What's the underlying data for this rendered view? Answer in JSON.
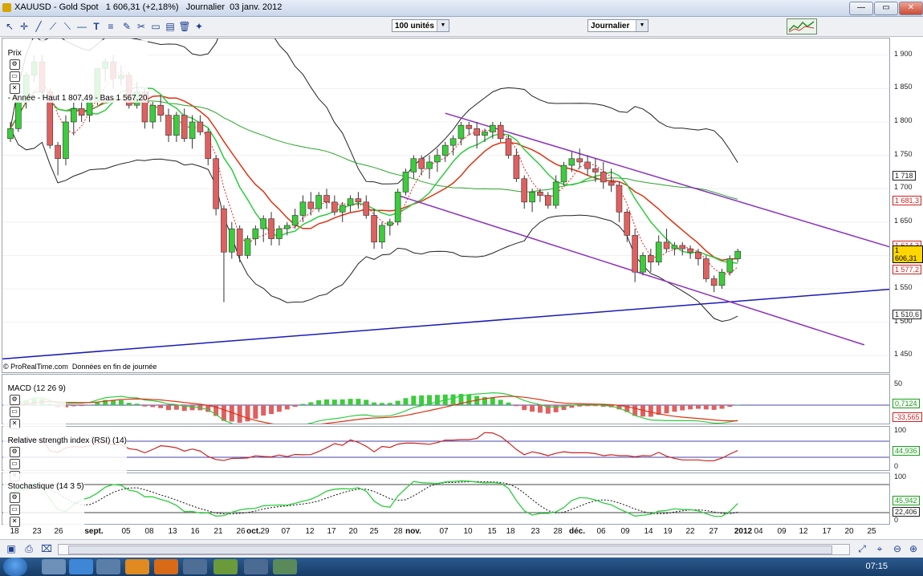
{
  "window": {
    "title": "XAUUSD - Gold Spot   1 606,31 (+2,18%)   Journalier  03 janv. 2012",
    "buttons": [
      "—",
      "▭",
      "✕"
    ]
  },
  "toolbar": {
    "units_value": "100 unités",
    "timeframe_value": "Journalier",
    "tools": [
      "pointer-icon",
      "crosshair-icon",
      "line-icon",
      "ray-icon",
      "trend-icon",
      "h-line-icon",
      "text-icon",
      "fibo-icon",
      "pencil-icon",
      "cut-icon",
      "rect-icon",
      "note-icon",
      "trash-icon",
      "magic-icon"
    ]
  },
  "panels": {
    "price": {
      "header": "Prix",
      "info": "- Année - Haut 1 807,49 - Bas 1 567,20",
      "credit": "© ProRealTime.com  Données en fin de journée",
      "y_labels": [
        "1 900",
        "1 850",
        "1 800",
        "1 750",
        "1 700",
        "1 650",
        "1 600",
        "1 550",
        "1 500",
        "1 450"
      ],
      "tags": [
        {
          "text": "1 718",
          "color": "#222222"
        },
        {
          "text": "1 681,3",
          "color": "#cc2222"
        },
        {
          "text": "1 614,3",
          "color": "#cc2222"
        },
        {
          "text": "1 606,31",
          "color": "#000000",
          "bg": "#ffd700"
        },
        {
          "text": "1 577,2",
          "color": "#cc2222"
        },
        {
          "text": "1 510,6",
          "color": "#222222"
        }
      ]
    },
    "macd": {
      "header": "MACD (12 26 9)",
      "y_labels": [
        "50"
      ],
      "tags": [
        {
          "text": "0,7124",
          "color": "#16a016"
        },
        {
          "text": "-33,565",
          "color": "#cc2222"
        }
      ]
    },
    "rsi": {
      "header": "Relative strength index (RSI) (14)",
      "y_labels": [
        "100",
        "0"
      ],
      "tags": [
        {
          "text": "44,936",
          "color": "#16a016"
        }
      ]
    },
    "stoch": {
      "header": "Stochastique (14 3 5)",
      "y_labels": [
        "100",
        "0"
      ],
      "tags": [
        {
          "text": "45,942",
          "color": "#16a016"
        },
        {
          "text": "22,406",
          "color": "#222222"
        }
      ]
    }
  },
  "x_axis": {
    "labels": [
      "18",
      "23",
      "26",
      "sept.",
      "05",
      "08",
      "13",
      "16",
      "21",
      "26",
      "29",
      "oct.",
      "07",
      "12",
      "17",
      "20",
      "25",
      "28",
      "nov.",
      "07",
      "10",
      "15",
      "18",
      "23",
      "28",
      "déc.",
      "06",
      "09",
      "14",
      "19",
      "22",
      "27",
      "2012",
      "04",
      "09",
      "12",
      "17",
      "20",
      "25"
    ],
    "bold": [
      "sept.",
      "oct.",
      "nov.",
      "déc.",
      "2012"
    ]
  },
  "taskbar": {
    "time": "07:15"
  },
  "chart_data": {
    "type": "candlestick",
    "title": "XAUUSD - Gold Spot",
    "frequency": "Journalier",
    "ylim": [
      1425,
      1925
    ],
    "last_close": 1606.31,
    "year_high": 1807.49,
    "year_low": 1567.2,
    "candles": [
      [
        1775,
        1800,
        1770,
        1790
      ],
      [
        1790,
        1840,
        1785,
        1830
      ],
      [
        1830,
        1875,
        1820,
        1870
      ],
      [
        1870,
        1900,
        1860,
        1890
      ],
      [
        1890,
        1900,
        1835,
        1845
      ],
      [
        1845,
        1850,
        1760,
        1765
      ],
      [
        1765,
        1770,
        1720,
        1745
      ],
      [
        1745,
        1810,
        1735,
        1800
      ],
      [
        1800,
        1830,
        1780,
        1820
      ],
      [
        1820,
        1840,
        1800,
        1810
      ],
      [
        1810,
        1830,
        1800,
        1830
      ],
      [
        1830,
        1880,
        1825,
        1880
      ],
      [
        1880,
        1895,
        1860,
        1890
      ],
      [
        1890,
        1900,
        1850,
        1865
      ],
      [
        1865,
        1885,
        1855,
        1870
      ],
      [
        1870,
        1875,
        1820,
        1825
      ],
      [
        1825,
        1860,
        1820,
        1845
      ],
      [
        1845,
        1850,
        1790,
        1800
      ],
      [
        1800,
        1830,
        1790,
        1825
      ],
      [
        1825,
        1840,
        1800,
        1810
      ],
      [
        1810,
        1820,
        1770,
        1780
      ],
      [
        1780,
        1815,
        1770,
        1810
      ],
      [
        1810,
        1820,
        1770,
        1775
      ],
      [
        1775,
        1810,
        1760,
        1800
      ],
      [
        1800,
        1810,
        1780,
        1785
      ],
      [
        1785,
        1790,
        1735,
        1745
      ],
      [
        1745,
        1750,
        1660,
        1670
      ],
      [
        1670,
        1675,
        1530,
        1605
      ],
      [
        1605,
        1650,
        1595,
        1640
      ],
      [
        1640,
        1645,
        1590,
        1600
      ],
      [
        1600,
        1630,
        1595,
        1625
      ],
      [
        1625,
        1645,
        1615,
        1640
      ],
      [
        1640,
        1660,
        1620,
        1655
      ],
      [
        1655,
        1665,
        1615,
        1625
      ],
      [
        1625,
        1645,
        1615,
        1640
      ],
      [
        1640,
        1650,
        1630,
        1645
      ],
      [
        1645,
        1670,
        1640,
        1660
      ],
      [
        1660,
        1690,
        1650,
        1680
      ],
      [
        1680,
        1695,
        1660,
        1670
      ],
      [
        1670,
        1695,
        1665,
        1690
      ],
      [
        1690,
        1700,
        1670,
        1680
      ],
      [
        1680,
        1690,
        1660,
        1665
      ],
      [
        1665,
        1680,
        1650,
        1675
      ],
      [
        1675,
        1690,
        1665,
        1685
      ],
      [
        1685,
        1695,
        1670,
        1680
      ],
      [
        1680,
        1690,
        1655,
        1660
      ],
      [
        1660,
        1670,
        1610,
        1620
      ],
      [
        1620,
        1650,
        1610,
        1645
      ],
      [
        1645,
        1655,
        1630,
        1650
      ],
      [
        1650,
        1700,
        1645,
        1695
      ],
      [
        1695,
        1730,
        1690,
        1725
      ],
      [
        1725,
        1750,
        1715,
        1745
      ],
      [
        1745,
        1750,
        1720,
        1730
      ],
      [
        1730,
        1750,
        1715,
        1740
      ],
      [
        1740,
        1760,
        1725,
        1750
      ],
      [
        1750,
        1770,
        1740,
        1765
      ],
      [
        1765,
        1780,
        1750,
        1775
      ],
      [
        1775,
        1800,
        1765,
        1795
      ],
      [
        1795,
        1800,
        1780,
        1790
      ],
      [
        1790,
        1800,
        1760,
        1780
      ],
      [
        1780,
        1790,
        1770,
        1785
      ],
      [
        1785,
        1800,
        1775,
        1795
      ],
      [
        1795,
        1800,
        1770,
        1775
      ],
      [
        1775,
        1780,
        1745,
        1750
      ],
      [
        1750,
        1760,
        1710,
        1715
      ],
      [
        1715,
        1720,
        1670,
        1680
      ],
      [
        1680,
        1700,
        1665,
        1695
      ],
      [
        1695,
        1700,
        1680,
        1690
      ],
      [
        1690,
        1695,
        1670,
        1675
      ],
      [
        1675,
        1720,
        1670,
        1710
      ],
      [
        1710,
        1740,
        1705,
        1735
      ],
      [
        1735,
        1755,
        1725,
        1745
      ],
      [
        1745,
        1760,
        1730,
        1740
      ],
      [
        1740,
        1750,
        1720,
        1730
      ],
      [
        1730,
        1745,
        1710,
        1725
      ],
      [
        1725,
        1740,
        1700,
        1710
      ],
      [
        1710,
        1730,
        1695,
        1705
      ],
      [
        1705,
        1710,
        1650,
        1665
      ],
      [
        1665,
        1670,
        1620,
        1630
      ],
      [
        1630,
        1640,
        1560,
        1575
      ],
      [
        1575,
        1605,
        1570,
        1600
      ],
      [
        1600,
        1610,
        1575,
        1590
      ],
      [
        1590,
        1630,
        1585,
        1620
      ],
      [
        1620,
        1640,
        1605,
        1610
      ],
      [
        1610,
        1620,
        1600,
        1615
      ],
      [
        1615,
        1620,
        1600,
        1610
      ],
      [
        1610,
        1615,
        1595,
        1605
      ],
      [
        1605,
        1610,
        1585,
        1595
      ],
      [
        1595,
        1600,
        1560,
        1565
      ],
      [
        1565,
        1570,
        1545,
        1555
      ],
      [
        1555,
        1580,
        1550,
        1575
      ],
      [
        1575,
        1600,
        1570,
        1595
      ],
      [
        1595,
        1610,
        1590,
        1606.31
      ]
    ]
  }
}
